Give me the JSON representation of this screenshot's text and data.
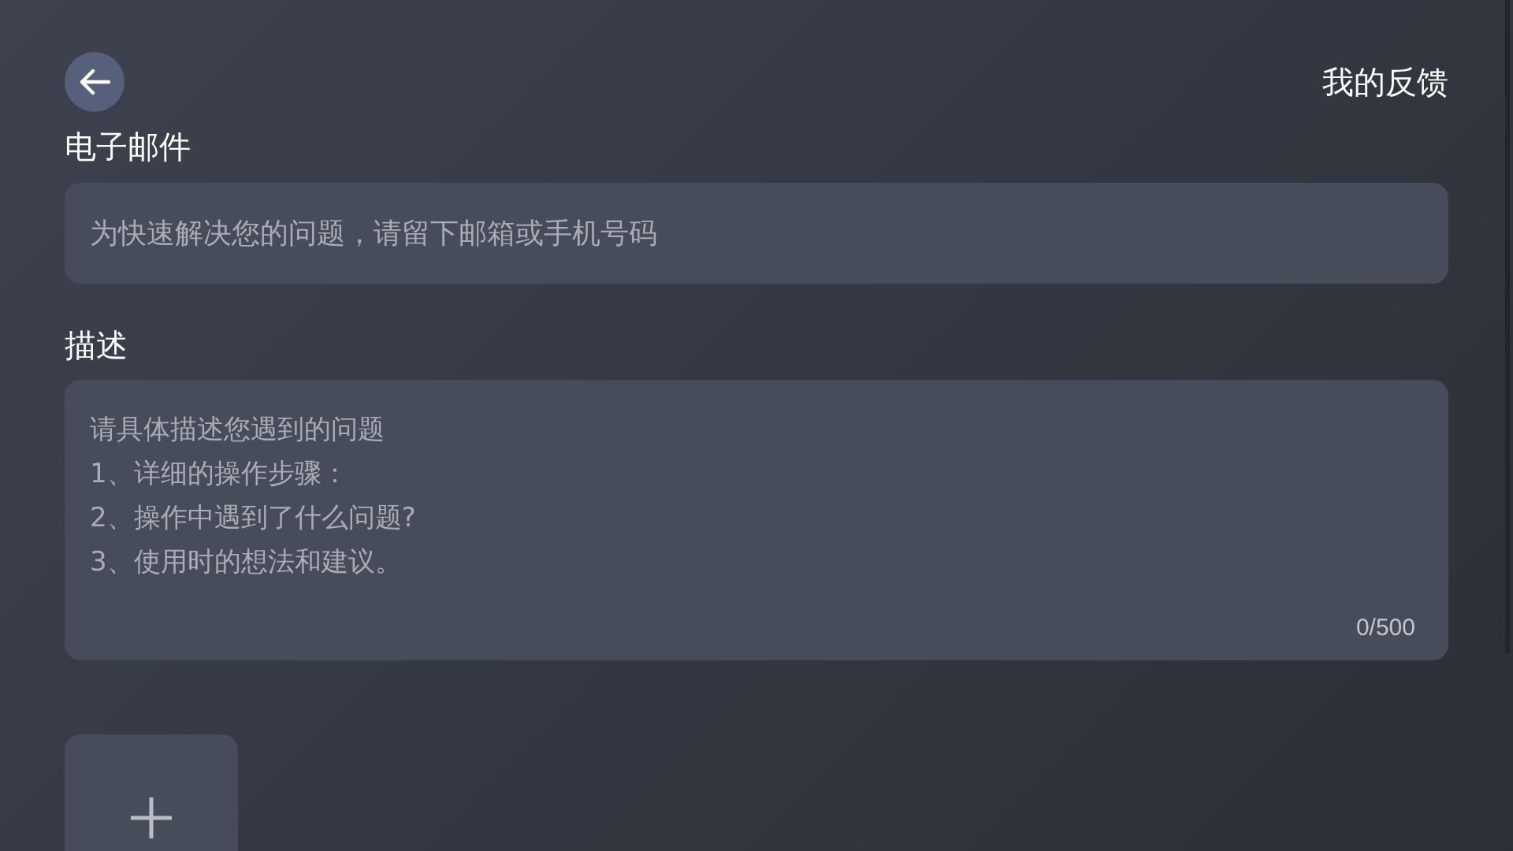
{
  "header": {
    "title": "我的反馈"
  },
  "email": {
    "label": "电子邮件",
    "placeholder": "为快速解决您的问题，请留下邮箱或手机号码"
  },
  "description": {
    "label": "描述",
    "placeholder": "请具体描述您遇到的问题\n1、详细的操作步骤：\n2、操作中遇到了什么问题?\n3、使用时的想法和建议。",
    "counter": "0/500"
  }
}
